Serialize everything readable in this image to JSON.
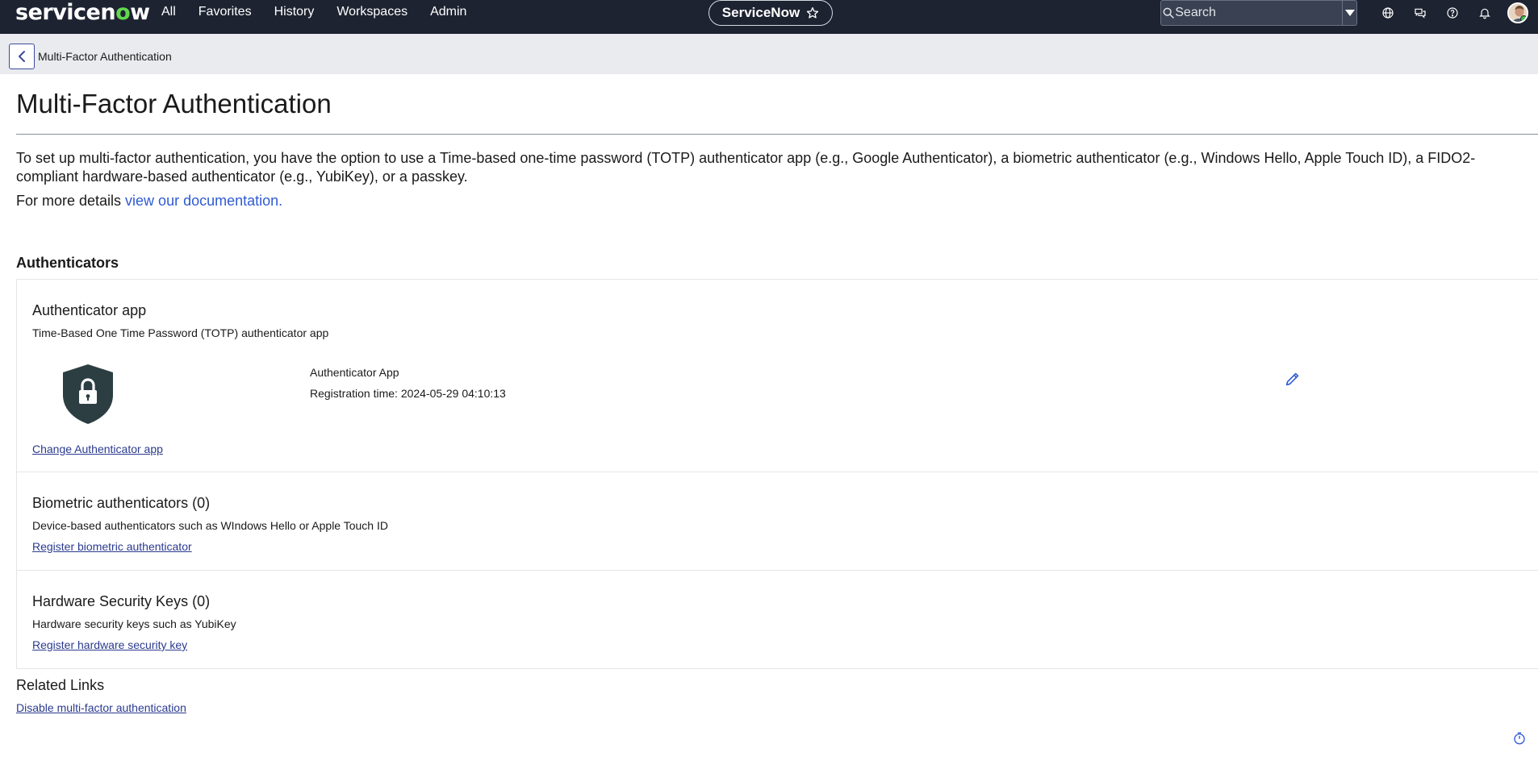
{
  "topbar": {
    "logo_text_before": "servicen",
    "logo_text_o": "o",
    "logo_text_after": "w",
    "nav": [
      "All",
      "Favorites",
      "History",
      "Workspaces",
      "Admin"
    ],
    "center_pill_label": "ServiceNow",
    "search_placeholder": "Search",
    "icons": [
      "globe-icon",
      "chat-icon",
      "help-icon",
      "bell-icon"
    ]
  },
  "subheader": {
    "title": "Multi-Factor Authentication"
  },
  "page": {
    "title": "Multi-Factor Authentication",
    "intro": "To set up multi-factor authentication, you have the option to use a Time-based one-time password (TOTP) authenticator app (e.g., Google Authenticator), a biometric authenticator (e.g., Windows Hello, Apple Touch ID), a FIDO2-compliant hardware-based authenticator (e.g., YubiKey), or a passkey.",
    "more_prefix": "For more details ",
    "more_link": "view our documentation."
  },
  "authenticators": {
    "section_title": "Authenticators",
    "app": {
      "title": "Authenticator app",
      "desc": "Time-Based One Time Password (TOTP) authenticator app",
      "name": "Authenticator App",
      "registration": "Registration time: 2024-05-29 04:10:13",
      "change_link": "Change Authenticator app"
    },
    "biometric": {
      "title": "Biometric authenticators (0)",
      "desc": "Device-based authenticators such as WIndows Hello or Apple Touch ID",
      "link": "Register biometric authenticator"
    },
    "hardware": {
      "title": "Hardware Security Keys (0)",
      "desc": "Hardware security keys such as YubiKey",
      "link": "Register hardware security key"
    }
  },
  "related": {
    "title": "Related Links",
    "link": "Disable multi-factor authentication"
  },
  "colors": {
    "topbar": "#1d2331",
    "link": "#2f5bd2",
    "shield": "#2c3e42",
    "accent_green": "#62d84e"
  }
}
